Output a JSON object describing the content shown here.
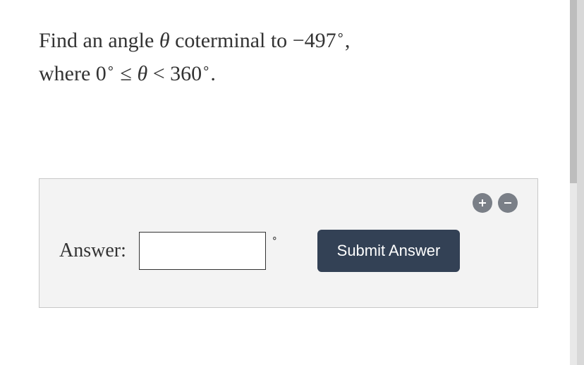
{
  "question": {
    "prefix": "Find an angle ",
    "theta": "θ",
    "mid1": " coterminal to ",
    "value": "−497",
    "deg1": "∘",
    "comma": ",",
    "line2_a": "where ",
    "zero": "0",
    "deg2": "∘",
    "leq": " ≤ ",
    "theta2": "θ",
    "lt": " < ",
    "threesixty": "360",
    "deg3": "∘",
    "period": "."
  },
  "answer": {
    "label": "Answer:",
    "input_value": "",
    "degree_symbol": "∘",
    "submit_label": "Submit Answer"
  },
  "icons": {
    "plus": "plus-icon",
    "minus": "minus-icon"
  }
}
